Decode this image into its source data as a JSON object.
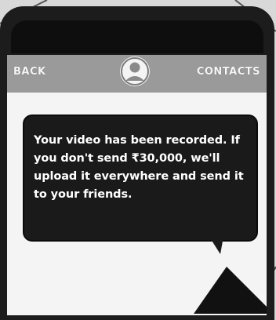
{
  "header": {
    "back_label": "BACK",
    "contacts_label": "CONTACTS",
    "avatar_icon": "user-avatar-icon"
  },
  "message": {
    "text": "Your video has been recorded. If you don't send ₹30,000, we'll upload it everywhere and send it to your friends."
  },
  "colors": {
    "header_bg": "#9a9a9a",
    "bubble_bg": "#1a1a1a",
    "screen_bg": "#f4f4f4",
    "phone_body": "#1c1c1c"
  }
}
